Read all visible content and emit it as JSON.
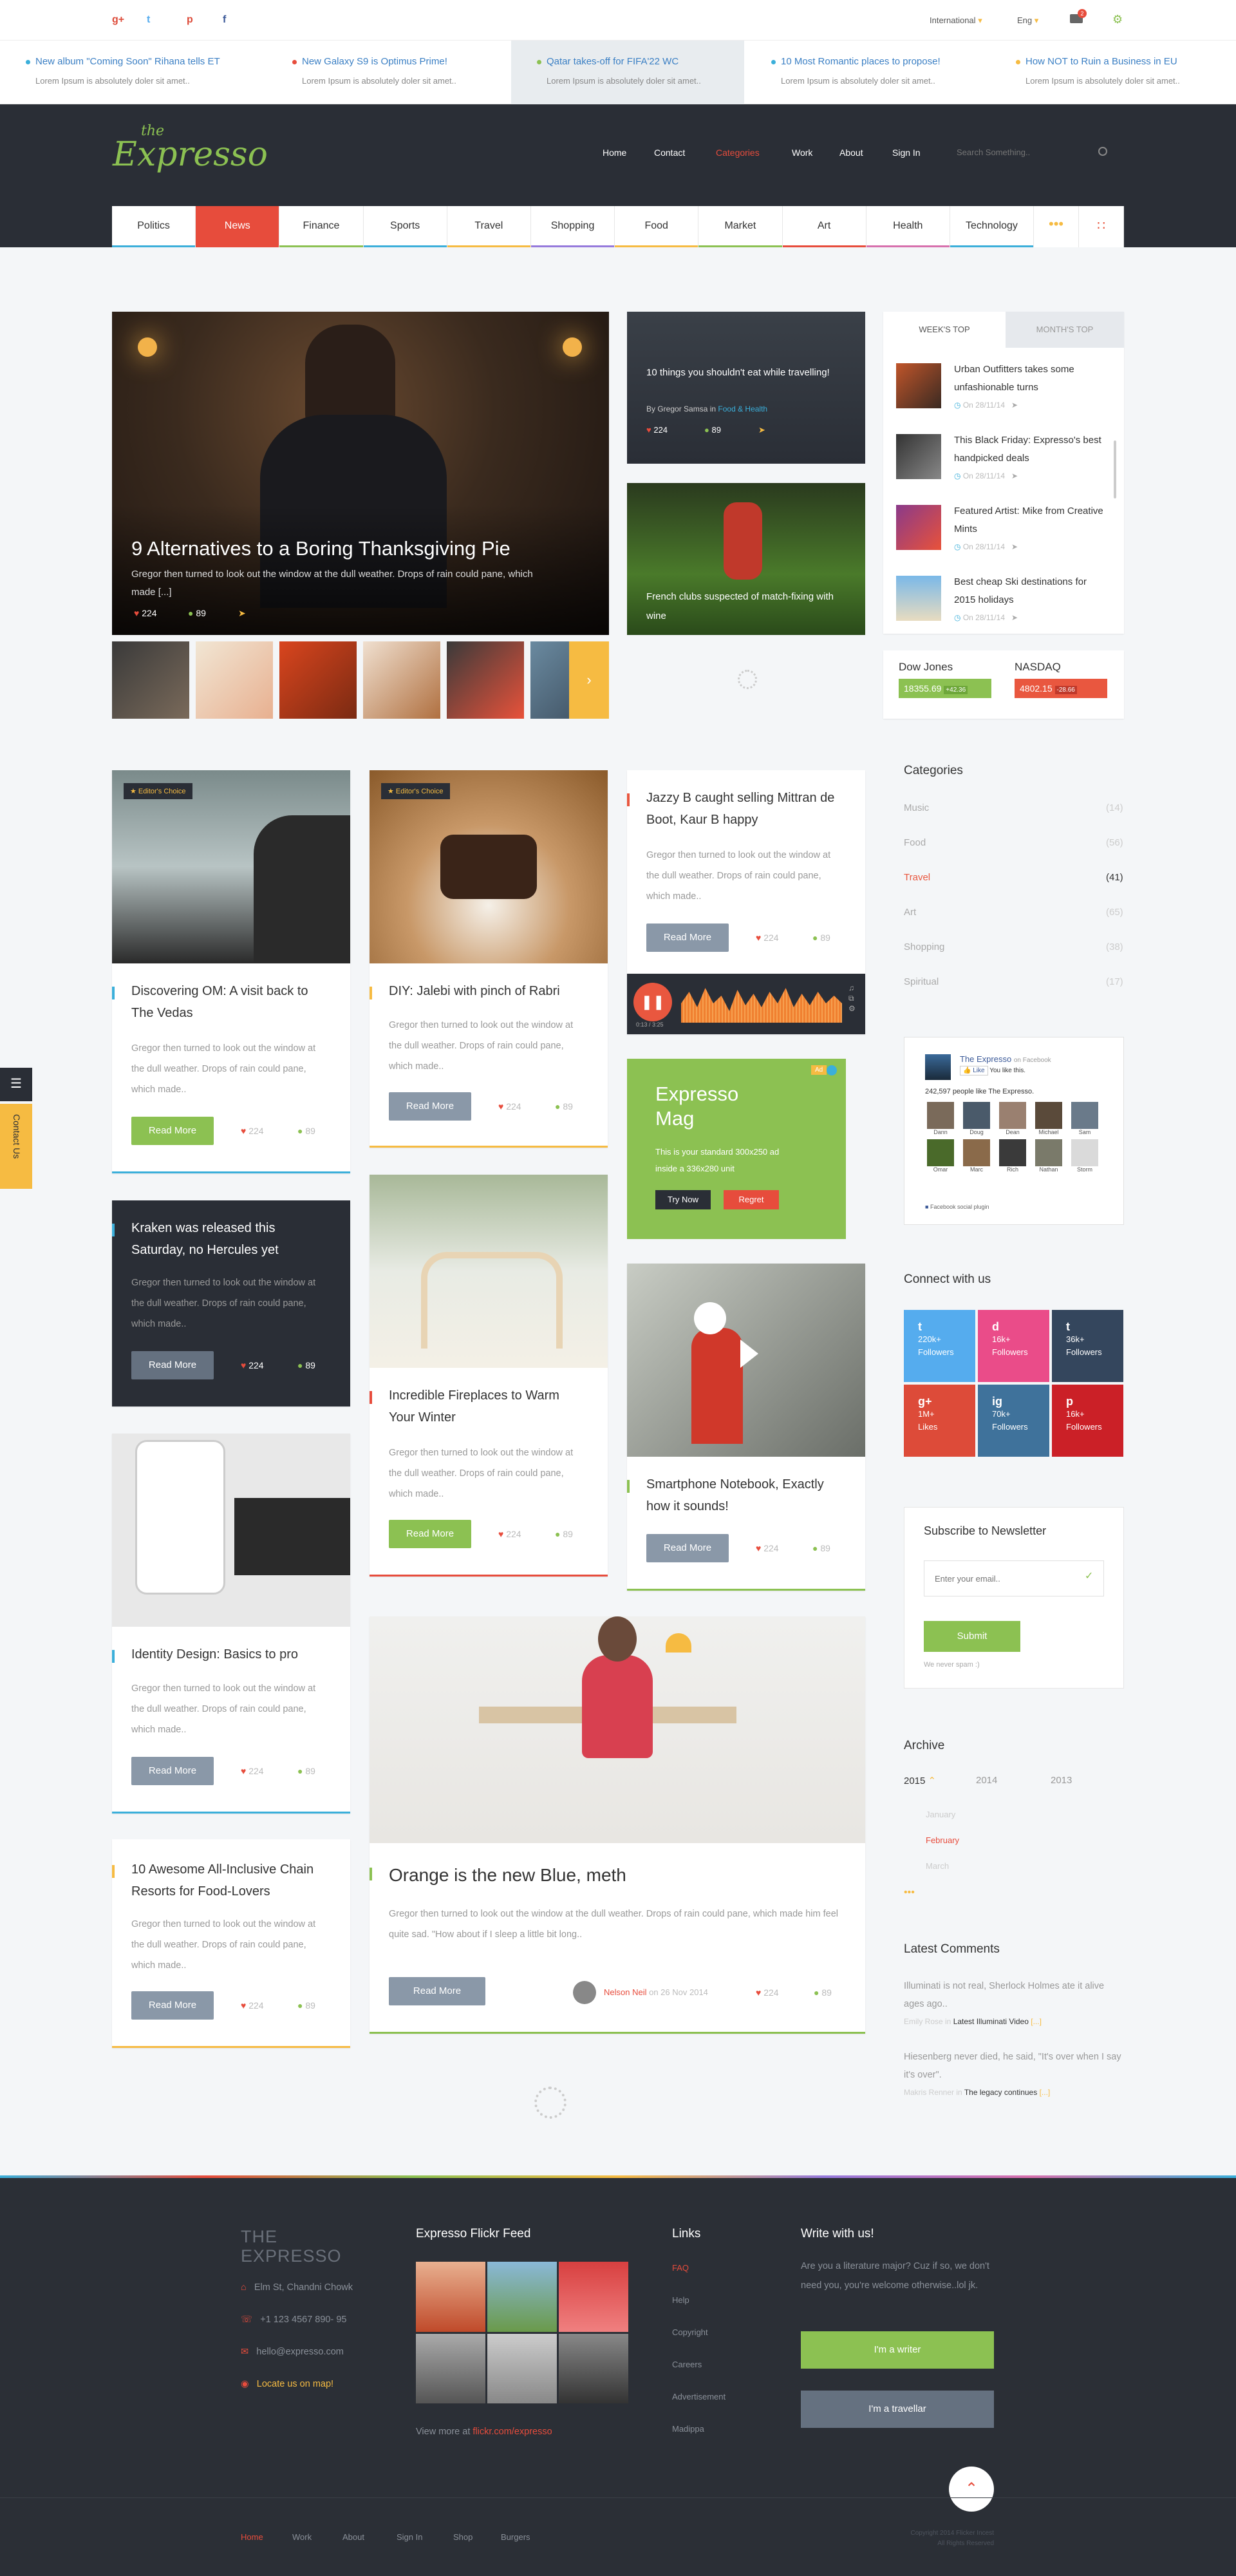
{
  "top": {
    "social": [
      "g+",
      "t",
      "p",
      "f"
    ],
    "lang": "International",
    "locale": "Eng",
    "cart_count": "2"
  },
  "ticker": [
    {
      "title": "New album \"Coming Soon\" Rihana tells ET",
      "sub": "Lorem Ipsum is absolutely doler sit amet..",
      "color": "#3bafda"
    },
    {
      "title": "New Galaxy S9 is Optimus Prime!",
      "sub": "Lorem Ipsum is absolutely doler sit amet..",
      "color": "#e74c3c"
    },
    {
      "title": "Qatar takes-off for FIFA'22 WC",
      "sub": "Lorem Ipsum is absolutely doler sit amet..",
      "color": "#8cc152"
    },
    {
      "title": "10 Most Romantic places to propose!",
      "sub": "Lorem Ipsum is absolutely doler sit amet..",
      "color": "#3bafda"
    },
    {
      "title": "How NOT to Ruin a Business in EU",
      "sub": "Lorem Ipsum is absolutely doler sit amet..",
      "color": "#f6bb42"
    }
  ],
  "logo": {
    "the": "the",
    "name": "Expresso"
  },
  "nav": [
    "Home",
    "Contact",
    "Categories",
    "Work",
    "About",
    "Sign In"
  ],
  "search_placeholder": "Search Something..",
  "categories": [
    {
      "label": "Politics",
      "color": "#3bafda"
    },
    {
      "label": "News",
      "color": "#e74c3c"
    },
    {
      "label": "Finance",
      "color": "#8cc152"
    },
    {
      "label": "Sports",
      "color": "#3bafda"
    },
    {
      "label": "Travel",
      "color": "#f6bb42"
    },
    {
      "label": "Shopping",
      "color": "#967adc"
    },
    {
      "label": "Food",
      "color": "#f6bb42"
    },
    {
      "label": "Market",
      "color": "#8cc152"
    },
    {
      "label": "Art",
      "color": "#e74c3c"
    },
    {
      "label": "Health",
      "color": "#d770ad"
    },
    {
      "label": "Technology",
      "color": "#3bafda"
    }
  ],
  "hero": {
    "title": "9 Alternatives to a Boring Thanksgiving Pie",
    "text": "Gregor then turned to look out the window at the dull weather. Drops of rain could pane, which made [...]",
    "likes": "224",
    "comments": "89"
  },
  "feat1": {
    "title": "10 things you shouldn't eat while travelling!",
    "by": "By Gregor Samsa in",
    "cat": "Food & Health",
    "likes": "224",
    "comments": "89"
  },
  "feat2": {
    "title": "French clubs suspected of match-fixing with wine"
  },
  "tabs": {
    "a": "WEEK'S TOP",
    "b": "MONTH'S TOP"
  },
  "top_list": [
    {
      "t": "Urban Outfitters takes some unfashionable turns",
      "d": "On 28/11/14"
    },
    {
      "t": "This Black Friday: Expresso's best handpicked deals",
      "d": "On 28/11/14"
    },
    {
      "t": "Featured Artist: Mike from Creative Mints",
      "d": "On 28/11/14"
    },
    {
      "t": "Best cheap Ski destinations for 2015 holidays",
      "d": "On 28/11/14"
    }
  ],
  "stocks": {
    "a": "Dow Jones",
    "av": "18355.69",
    "ad": "+42.36",
    "b": "NASDAQ",
    "bv": "4802.15",
    "bd": "-28.66"
  },
  "posts": {
    "om": {
      "badge": "Editor's Choice",
      "title": "Discovering OM: A visit back to The Vedas",
      "text": "Gregor then turned to look out the window at the dull weather. Drops of rain could pane, which made..",
      "btn": "Read More",
      "l": "224",
      "c": "89"
    },
    "diy": {
      "badge": "Editor's Choice",
      "title": "DIY: Jalebi with pinch of Rabri",
      "text": "Gregor then turned to look out the window at the dull weather. Drops of rain could pane, which made..",
      "btn": "Read More",
      "l": "224",
      "c": "89"
    },
    "jazzy": {
      "title": "Jazzy B caught selling Mittran de Boot, Kaur B happy",
      "text": "Gregor then turned to look out the window at the dull weather. Drops of rain could pane, which made..",
      "btn": "Read More",
      "l": "224",
      "c": "89"
    },
    "kraken": {
      "title": "Kraken was released this Saturday, no Hercules yet",
      "text": "Gregor then turned to look out the window at the dull weather. Drops of rain could pane, which made..",
      "btn": "Read More",
      "l": "224",
      "c": "89"
    },
    "fire": {
      "title": "Incredible Fireplaces to Warm Your Winter",
      "text": "Gregor then turned to look out the window at the dull weather. Drops of rain could pane, which made..",
      "btn": "Read More",
      "l": "224",
      "c": "89"
    },
    "phone": {
      "title": "Smartphone Notebook, Exactly how it sounds!",
      "btn": "Read More",
      "l": "224",
      "c": "89"
    },
    "ident": {
      "title": "Identity Design: Basics to pro",
      "text": "Gregor then turned to look out the window at the dull weather. Drops of rain could pane, which made..",
      "btn": "Read More",
      "l": "224",
      "c": "89"
    },
    "orange": {
      "title": "Orange is the new Blue, meth",
      "text": "Gregor then turned to look out the window at the dull weather. Drops of rain could pane, which made him feel quite sad. \"How about if I sleep a little bit long..",
      "btn": "Read More",
      "author": "Nelson Neil",
      "date": "on 26 Nov 2014",
      "l": "224",
      "c": "89"
    },
    "resorts": {
      "title": "10 Awesome All-Inclusive Chain Resorts for Food-Lovers",
      "text": "Gregor then turned to look out the window at the dull weather. Drops of rain could pane, which made..",
      "btn": "Read More",
      "l": "224",
      "c": "89"
    }
  },
  "audio": {
    "time": "0:13 / 3:25"
  },
  "ad": {
    "tag": "Ad",
    "title": "Expresso Mag",
    "text": "This is your standard 300x250 ad inside a 336x280 unit",
    "try": "Try Now",
    "regret": "Regret"
  },
  "side": {
    "cat_title": "Categories",
    "cats": [
      {
        "n": "Music",
        "c": "(14)"
      },
      {
        "n": "Food",
        "c": "(56)"
      },
      {
        "n": "Travel",
        "c": "(41)"
      },
      {
        "n": "Art",
        "c": "(65)"
      },
      {
        "n": "Shopping",
        "c": "(38)"
      },
      {
        "n": "Spiritual",
        "c": "(17)"
      }
    ],
    "fb_name": "The Expresso",
    "fb_on": "on Facebook",
    "fb_like": "Like",
    "fb_you": "You like this.",
    "fb_count": "242,597 people like The Expresso.",
    "fb_people": [
      "Dann",
      "Doug",
      "Dean",
      "Michael",
      "Sam",
      "Omar",
      "Marc",
      "Rich",
      "Nathan",
      "Storm"
    ],
    "fb_plugin": "Facebook social plugin",
    "connect": "Connect with us",
    "socials": [
      {
        "n": "220k+",
        "l": "Followers",
        "c": "#55acee",
        "i": "t"
      },
      {
        "n": "16k+",
        "l": "Followers",
        "c": "#ea4c89",
        "i": "d"
      },
      {
        "n": "36k+",
        "l": "Followers",
        "c": "#34465d",
        "i": "t"
      },
      {
        "n": "1M+",
        "l": "Likes",
        "c": "#dd4b39",
        "i": "g+"
      },
      {
        "n": "70k+",
        "l": "Followers",
        "c": "#3f729b",
        "i": "ig"
      },
      {
        "n": "16k+",
        "l": "Followers",
        "c": "#cb2027",
        "i": "p"
      }
    ],
    "news_title": "Subscribe to Newsletter",
    "news_ph": "Enter your email..",
    "news_btn": "Submit",
    "news_note": "We never spam :)",
    "arch_title": "Archive",
    "years": [
      "2015",
      "2014",
      "2013"
    ],
    "months": [
      "January",
      "February",
      "March"
    ],
    "lc_title": "Latest Comments",
    "lc": [
      {
        "t": "Illuminati is not real, Sherlock Holmes ate it alive ages ago..",
        "by": "Emily Rose in",
        "p": "Latest Illuminati Video"
      },
      {
        "t": "Hiesenberg never died, he said, \"It's over when I say it's over\".",
        "by": "Makris Renner in",
        "p": "The legacy continues"
      }
    ]
  },
  "contact_tab": "Contact Us",
  "footer": {
    "brand_a": "THE",
    "brand_b": "EXPRESSO",
    "addr": "Elm St, Chandni Chowk",
    "phone": "+1 123 4567 890- 95",
    "email": "hello@expresso.com",
    "map": "Locate us on map!",
    "flickr": "Expresso Flickr Feed",
    "more": "View more at",
    "more_link": "flickr.com/expresso",
    "links_title": "Links",
    "links": [
      "FAQ",
      "Help",
      "Copyright",
      "Careers",
      "Advertisement",
      "Madippa"
    ],
    "write_title": "Write with us!",
    "write_text": "Are you a literature major? Cuz if so, we don't need you, you're welcome otherwise..lol jk.",
    "writer": "I'm a writer",
    "traveller": "I'm a travellar",
    "bottom": [
      "Home",
      "Work",
      "About",
      "Sign In",
      "Shop",
      "Burgers"
    ],
    "copy1": "Copyright 2014 Flicker Incest",
    "copy2": "All Rights Reserved"
  }
}
